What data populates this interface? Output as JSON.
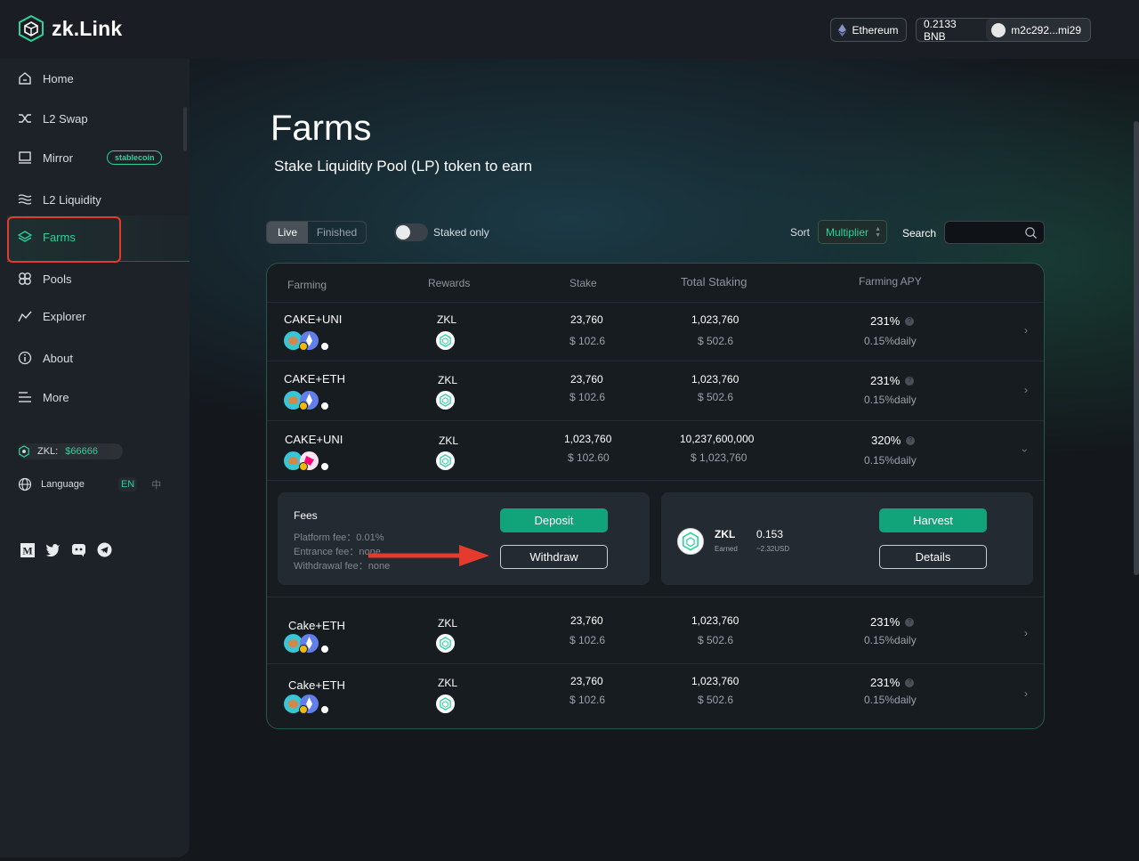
{
  "header": {
    "logo_text": "zk.Link",
    "network": "Ethereum",
    "balance": "0.2133 BNB",
    "address": "m2c292...mi29"
  },
  "sidebar": {
    "items": [
      {
        "label": "Home",
        "icon": "home-icon"
      },
      {
        "label": "L2 Swap",
        "icon": "swap-icon"
      },
      {
        "label": "Mirror",
        "icon": "mirror-icon",
        "badge": "stablecoin"
      },
      {
        "label": "L2 Liquidity",
        "icon": "liquidity-icon"
      },
      {
        "label": "Farms",
        "icon": "farms-icon",
        "active": true
      },
      {
        "label": "Pools",
        "icon": "pools-icon"
      },
      {
        "label": "Explorer",
        "icon": "explorer-icon"
      },
      {
        "label": "About",
        "icon": "info-icon"
      },
      {
        "label": "More",
        "icon": "menu-icon"
      }
    ],
    "zkl_label": "ZKL:",
    "zkl_price": "$66666",
    "language_label": "Language",
    "lang_en": "EN",
    "lang_zh": "中",
    "socials": [
      "medium-icon",
      "twitter-icon",
      "discord-icon",
      "telegram-icon"
    ]
  },
  "page": {
    "title": "Farms",
    "subtitle": "Stake Liquidity Pool (LP) token to earn"
  },
  "filters": {
    "tab_live": "Live",
    "tab_finished": "Finished",
    "staked_only": "Staked only",
    "sort_label": "Sort",
    "sort_value": "Multiplier",
    "search_label": "Search",
    "search_placeholder": ""
  },
  "table": {
    "headers": {
      "farming": "Farming",
      "rewards": "Rewards",
      "stake": "Stake",
      "total": "Total Staking",
      "apy": "Farming APY"
    },
    "rows": [
      {
        "pair": "CAKE+UNI",
        "reward": "ZKL",
        "stake": "23,760",
        "stake_usd": "$ 102.6",
        "total": "1,023,760",
        "total_usd": "$ 502.6",
        "apy": "231%",
        "daily": "0.15%daily",
        "second_coin": "eth"
      },
      {
        "pair": "CAKE+ETH",
        "reward": "ZKL",
        "stake": "23,760",
        "stake_usd": "$ 102.6",
        "total": "1,023,760",
        "total_usd": "$ 502.6",
        "apy": "231%",
        "daily": "0.15%daily",
        "second_coin": "eth"
      },
      {
        "pair": "CAKE+UNI",
        "reward": "ZKL",
        "stake": "1,023,760",
        "stake_usd": "$ 102.60",
        "total": "10,237,600,000",
        "total_usd": "$ 1,023,760",
        "apy": "320%",
        "daily": "0.15%daily",
        "second_coin": "uni",
        "expanded": true
      },
      {
        "pair": "Cake+ETH",
        "reward": "ZKL",
        "stake": "23,760",
        "stake_usd": "$ 102.6",
        "total": "1,023,760",
        "total_usd": "$ 502.6",
        "apy": "231%",
        "daily": "0.15%daily",
        "second_coin": "eth"
      },
      {
        "pair": "Cake+ETH",
        "reward": "ZKL",
        "stake": "23,760",
        "stake_usd": "$ 102.6",
        "total": "1,023,760",
        "total_usd": "$ 502.6",
        "apy": "231%",
        "daily": "0.15%daily",
        "second_coin": "eth"
      }
    ]
  },
  "expanded": {
    "fees_title": "Fees",
    "platform_fee": "Platform fee：0.01%",
    "entrance_fee": "Entrance fee：none",
    "withdrawal_fee": "Withdrawal fee：none",
    "deposit": "Deposit",
    "withdraw": "Withdraw",
    "token": "ZKL",
    "earned_label": "Earned",
    "earned_amount": "0.153",
    "earned_usd": "~2.32USD",
    "harvest": "Harvest",
    "details": "Details"
  },
  "colors": {
    "accent": "#2cd39a",
    "button_green": "#11a379",
    "highlight_red": "#e53b2e"
  }
}
